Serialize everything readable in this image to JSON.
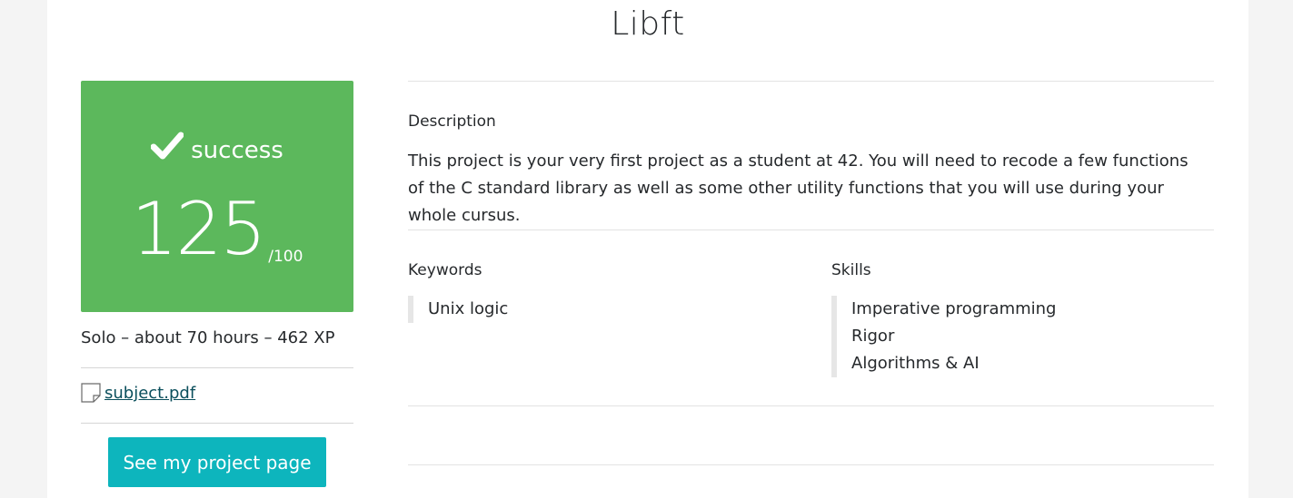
{
  "project": {
    "title": "Libft",
    "status": "success",
    "score": "125",
    "score_max": "/100",
    "meta": "Solo – about 70 hours – 462 XP",
    "subject_link": "subject.pdf",
    "project_button": "See my project page"
  },
  "description": {
    "label": "Description",
    "text": "This project is your very first project as a student at 42. You will need to recode a few functions of the C standard library as well as some other utility functions that you will use during your whole cursus."
  },
  "keywords": {
    "label": "Keywords",
    "items": [
      "Unix logic"
    ]
  },
  "skills": {
    "label": "Skills",
    "items": [
      "Imperative programming",
      "Rigor",
      "Algorithms & AI"
    ]
  },
  "colors": {
    "success_green": "#5cb85c",
    "button_teal": "#0db5bd",
    "link": "#0b4f5c"
  },
  "icons": {
    "status": "checkmark-icon",
    "subject": "document-icon"
  }
}
